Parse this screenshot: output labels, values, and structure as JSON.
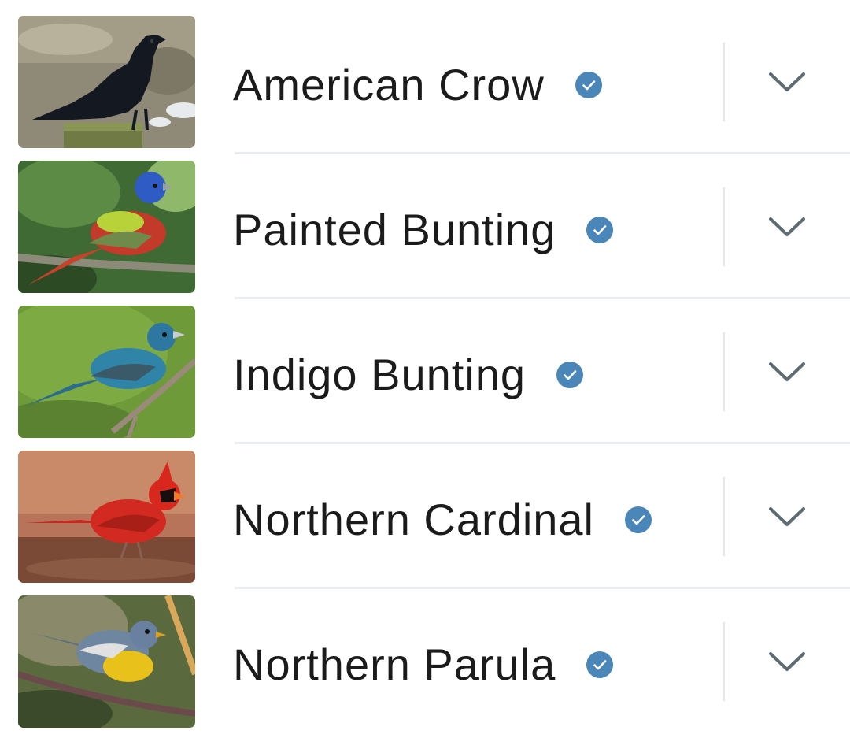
{
  "accent": {
    "verified_color": "#4a86b8",
    "chevron_color": "#5f6b72"
  },
  "species": [
    {
      "name": "American Crow",
      "badge_icon": "verified-check-icon",
      "expand_icon": "chevron-down-icon"
    },
    {
      "name": "Painted Bunting",
      "badge_icon": "verified-check-icon",
      "expand_icon": "chevron-down-icon"
    },
    {
      "name": "Indigo Bunting",
      "badge_icon": "verified-check-icon",
      "expand_icon": "chevron-down-icon"
    },
    {
      "name": "Northern Cardinal",
      "badge_icon": "verified-check-icon",
      "expand_icon": "chevron-down-icon"
    },
    {
      "name": "Northern Parula",
      "badge_icon": "verified-check-icon",
      "expand_icon": "chevron-down-icon"
    }
  ]
}
